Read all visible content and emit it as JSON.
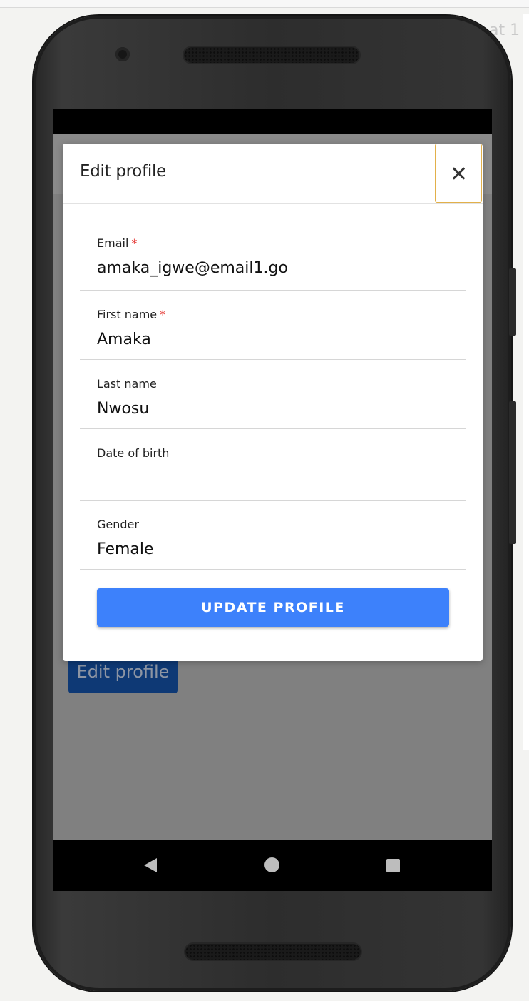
{
  "side_text": "at 1",
  "background_button": {
    "label": "Edit profile"
  },
  "modal": {
    "title": "Edit profile",
    "close_icon": "close-icon",
    "fields": [
      {
        "label": "Email",
        "required_mark": "*",
        "value": "amaka_igwe@email1.go"
      },
      {
        "label": "First name",
        "required_mark": "*",
        "value": "Amaka"
      },
      {
        "label": "Last name",
        "required_mark": "",
        "value": "Nwosu"
      },
      {
        "label": "Date of birth",
        "required_mark": "",
        "value": ""
      },
      {
        "label": "Gender",
        "required_mark": "",
        "value": "Female"
      }
    ],
    "submit_label": "UPDATE PROFILE"
  },
  "colors": {
    "primary": "#3d81fb",
    "required": "#e53935",
    "focus_outline": "#e2b04a",
    "overlay": "#808080",
    "dimmed_button": "#0e3975"
  }
}
